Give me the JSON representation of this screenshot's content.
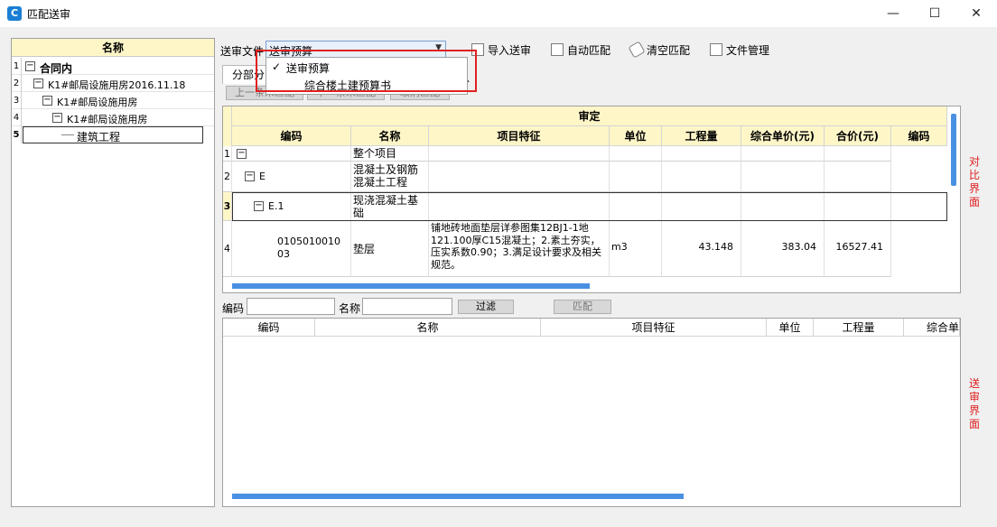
{
  "window": {
    "title": "匹配送审",
    "icon_label": "C",
    "minimize": "—",
    "maximize": "☐",
    "close": "✕"
  },
  "tree": {
    "header": "名称",
    "rows": [
      {
        "num": "1",
        "label": "合同内"
      },
      {
        "num": "2",
        "label": "K1#邮局设施用房2016.11.18"
      },
      {
        "num": "3",
        "label": "K1#邮局设施用房"
      },
      {
        "num": "4",
        "label": "K1#邮局设施用房"
      },
      {
        "num": "5",
        "label": "建筑工程"
      }
    ],
    "toggle": "−"
  },
  "toolbar": {
    "send_file_label": "送审文件",
    "send_file_value": "送审预算",
    "import": "导入送审",
    "auto_match": "自动匹配",
    "clear_match": "清空匹配",
    "file_manage": "文件管理"
  },
  "dropdown": {
    "items": [
      {
        "label": "送审预算",
        "checked": true
      },
      {
        "label": "综合楼土建预算书"
      }
    ],
    "check": "✓"
  },
  "tabs": {
    "tab1": "分部分",
    "tab2": "总"
  },
  "subbar": {
    "prev": "上一条未匹配",
    "next": "下一条未匹配",
    "cancel": "取消匹配"
  },
  "upper": {
    "group_header": "审定",
    "columns": [
      "编码",
      "名称",
      "项目特征",
      "单位",
      "工程量",
      "综合单价(元)",
      "合价(元)",
      "编码"
    ],
    "rows": [
      {
        "num": "1",
        "code": "",
        "name": "整个项目",
        "feature": "",
        "unit": "",
        "qty": "",
        "price": "",
        "total": ""
      },
      {
        "num": "2",
        "code": "E",
        "name": "混凝土及钢筋混凝土工程",
        "feature": "",
        "unit": "",
        "qty": "",
        "price": "",
        "total": ""
      },
      {
        "num": "3",
        "code": "E.1",
        "name": "现浇混凝土基础",
        "feature": "",
        "unit": "",
        "qty": "",
        "price": "",
        "total": ""
      },
      {
        "num": "4",
        "code": "010501001003",
        "name": "垫层",
        "feature": "铺地砖地面垫层详参图集12BJ1-1地121.100厚C15混凝土；2.素土夯实，压实系数0.90；3.满足设计要求及相关规范。",
        "unit": "m3",
        "qty": "43.148",
        "price": "383.04",
        "total": "16527.41"
      }
    ]
  },
  "filter": {
    "code_label": "编码",
    "name_label": "名称",
    "filter_btn": "过滤",
    "match_btn": "匹配"
  },
  "lower": {
    "columns": [
      "编码",
      "名称",
      "项目特征",
      "单位",
      "工程量",
      "综合单"
    ]
  },
  "side": {
    "compare": "对比界面",
    "send": "送审界面"
  },
  "colors": {
    "header_bg": "#fff6c8",
    "scroll": "#4a90e2",
    "highlight": "#e02020"
  }
}
